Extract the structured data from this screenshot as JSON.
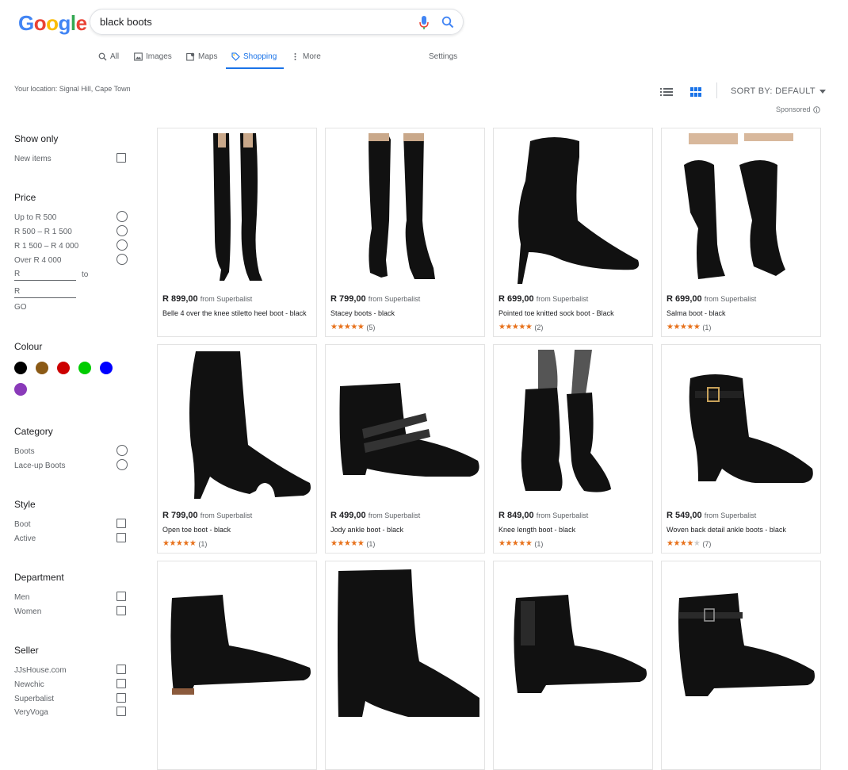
{
  "logo_letters": [
    "G",
    "o",
    "o",
    "g",
    "l",
    "e"
  ],
  "search": {
    "query": "black boots"
  },
  "tabs": [
    {
      "label": "All",
      "icon": "search-icon"
    },
    {
      "label": "Images",
      "icon": "image-icon"
    },
    {
      "label": "Maps",
      "icon": "map-icon"
    },
    {
      "label": "Shopping",
      "icon": "tag-icon",
      "active": true
    },
    {
      "label": "More",
      "icon": "more-vertical-icon"
    }
  ],
  "settings_label": "Settings",
  "location": "Your location: Signal Hill, Cape Town",
  "sort": {
    "label": "SORT BY: DEFAULT"
  },
  "sponsored": "Sponsored",
  "filters": {
    "show_only": {
      "title": "Show only",
      "items": [
        "New items"
      ]
    },
    "price": {
      "title": "Price",
      "items": [
        "Up to R 500",
        "R 500 – R 1 500",
        "R 1 500 – R 4 000",
        "Over R 4 000"
      ],
      "min_placeholder": "R",
      "to_label": "to",
      "max_placeholder": "R",
      "go_label": "GO"
    },
    "colour": {
      "title": "Colour",
      "swatches": [
        "#000000",
        "#8b5a16",
        "#cc0000",
        "#00cc00",
        "#0000ff",
        "#8a3ab9"
      ]
    },
    "category": {
      "title": "Category",
      "items": [
        "Boots",
        "Lace-up Boots"
      ]
    },
    "style": {
      "title": "Style",
      "items": [
        "Boot",
        "Active"
      ]
    },
    "department": {
      "title": "Department",
      "items": [
        "Men",
        "Women"
      ]
    },
    "seller": {
      "title": "Seller",
      "items": [
        "JJsHouse.com",
        "Newchic",
        "Superbalist",
        "VeryVoga"
      ]
    }
  },
  "products": [
    {
      "price": "R 899,00",
      "from": "from Superbalist",
      "title": "Belle 4 over the knee stiletto heel boot - black",
      "stars": 0,
      "reviews": "",
      "kind": "otk-heel"
    },
    {
      "price": "R 799,00",
      "from": "from Superbalist",
      "title": "Stacey boots - black",
      "stars": 5,
      "reviews": "(5)",
      "kind": "otk-block"
    },
    {
      "price": "R 699,00",
      "from": "from Superbalist",
      "title": "Pointed toe knitted sock boot - Black",
      "stars": 5,
      "reviews": "(2)",
      "kind": "sock"
    },
    {
      "price": "R 699,00",
      "from": "from Superbalist",
      "title": "Salma boot - black",
      "stars": 5,
      "reviews": "(1)",
      "kind": "slouch"
    },
    {
      "price": "R 799,00",
      "from": "from Superbalist",
      "title": "Open toe boot - black",
      "stars": 5,
      "reviews": "(1)",
      "kind": "peep"
    },
    {
      "price": "R 499,00",
      "from": "from Superbalist",
      "title": "Jody ankle boot - black",
      "stars": 5,
      "reviews": "(1)",
      "kind": "ankle-strap"
    },
    {
      "price": "R 849,00",
      "from": "from Superbalist",
      "title": "Knee length boot - black",
      "stars": 5,
      "reviews": "(1)",
      "kind": "knee"
    },
    {
      "price": "R 549,00",
      "from": "from Superbalist",
      "title": "Woven back detail ankle boots - black",
      "stars": 4,
      "reviews": "(7)",
      "kind": "buckle"
    },
    {
      "price": "",
      "from": "",
      "title": "",
      "stars": 0,
      "reviews": "",
      "kind": "chelsea-suede"
    },
    {
      "price": "",
      "from": "",
      "title": "",
      "stars": 0,
      "reviews": "",
      "kind": "block-heel"
    },
    {
      "price": "",
      "from": "",
      "title": "",
      "stars": 0,
      "reviews": "",
      "kind": "chelsea"
    },
    {
      "price": "",
      "from": "",
      "title": "",
      "stars": 0,
      "reviews": "",
      "kind": "strap-ankle"
    }
  ]
}
